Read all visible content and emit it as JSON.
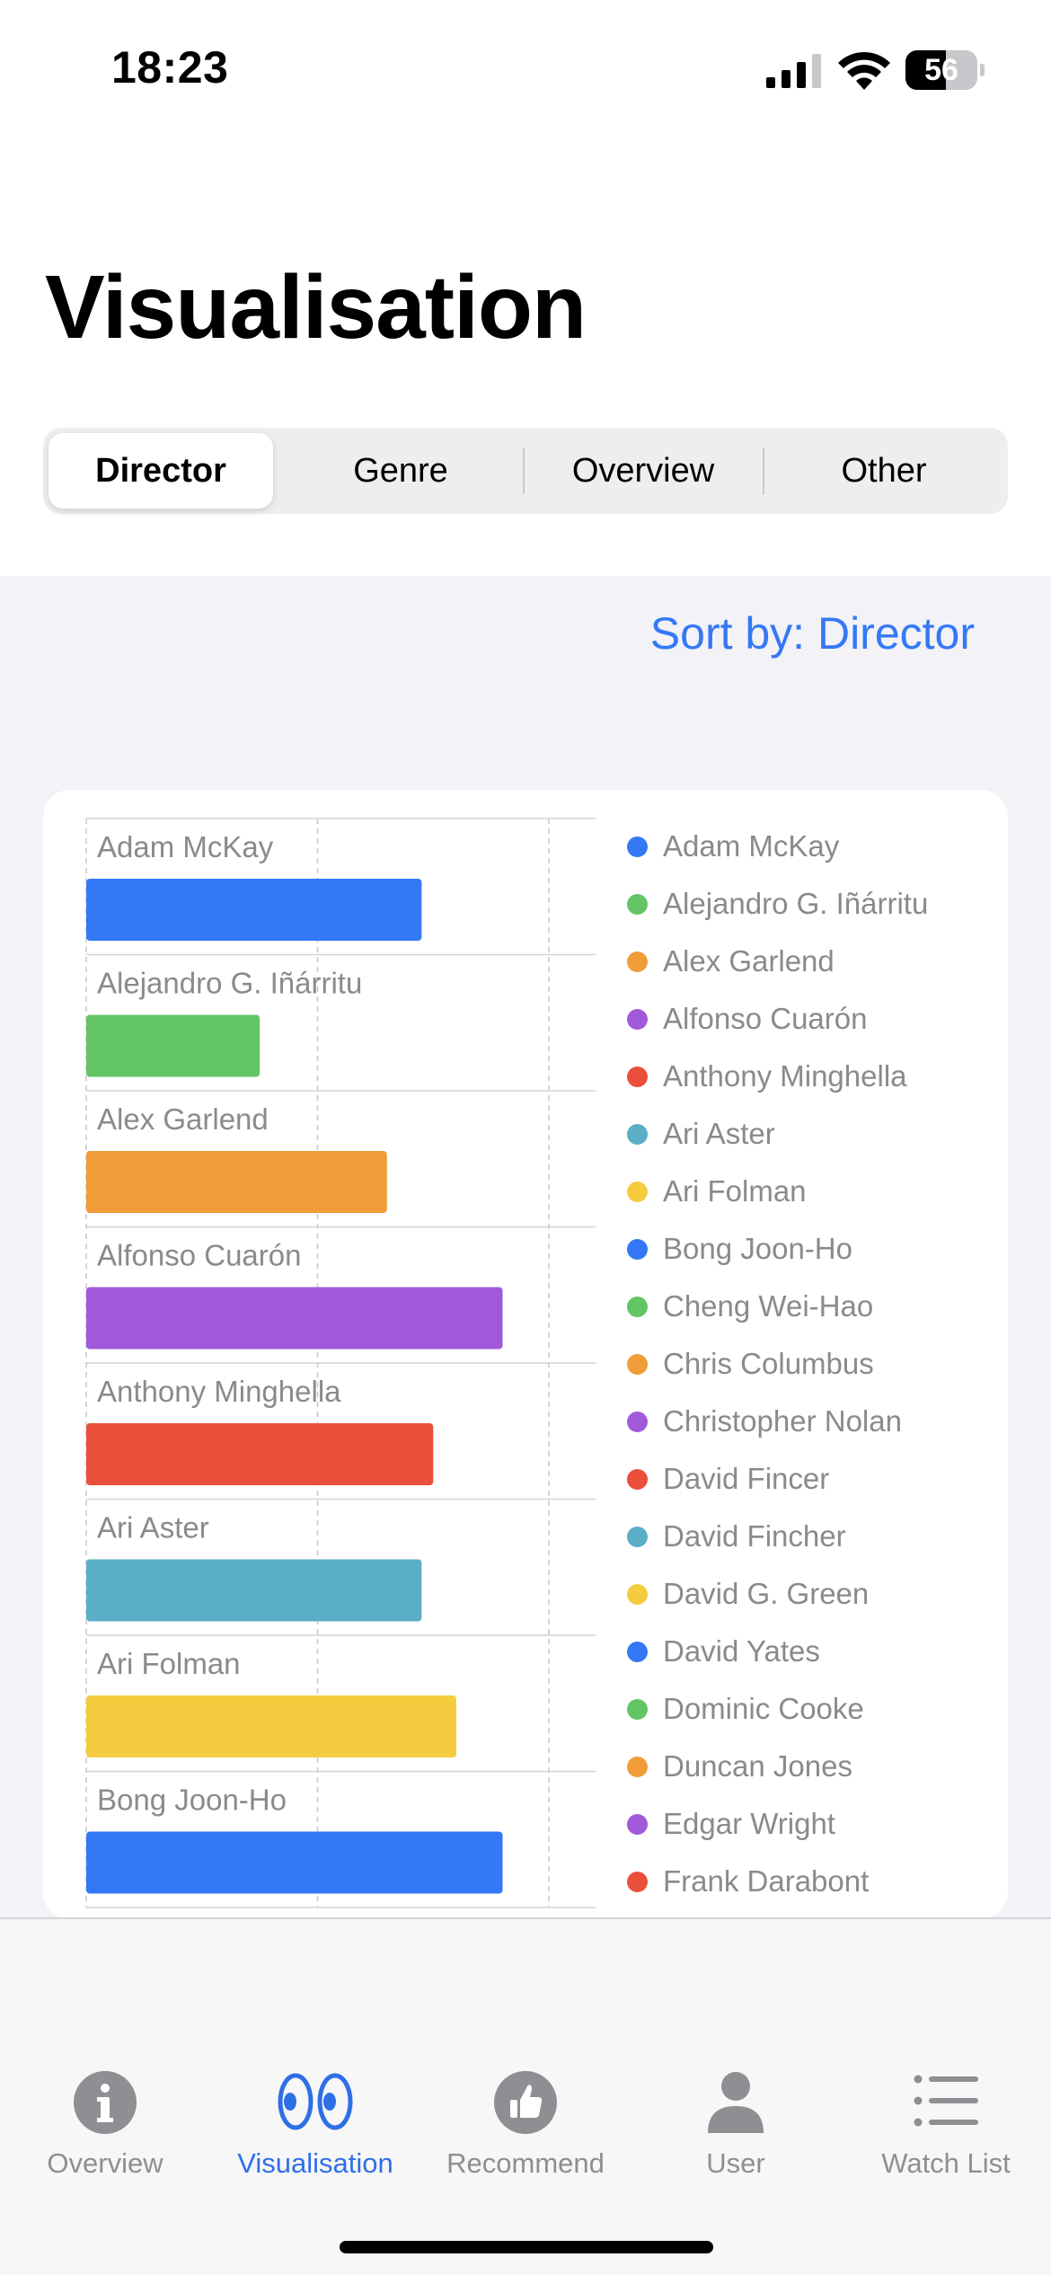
{
  "status_bar": {
    "time": "18:23",
    "battery_level": "56",
    "battery_fraction": 0.56
  },
  "page": {
    "title": "Visualisation"
  },
  "segments": [
    {
      "label": "Director",
      "selected": true
    },
    {
      "label": "Genre",
      "selected": false
    },
    {
      "label": "Overview",
      "selected": false
    },
    {
      "label": "Other",
      "selected": false
    }
  ],
  "sort": {
    "label": "Sort by: Director"
  },
  "chart_data": {
    "type": "bar",
    "orientation": "horizontal",
    "grid": true,
    "legend_position": "right",
    "xlim": [
      0,
      2
    ],
    "categories": [
      "Adam McKay",
      "Alejandro G. Iñárritu",
      "Alex Garlend",
      "Alfonso Cuarón",
      "Anthony Minghella",
      "Ari Aster",
      "Ari Folman",
      "Bong Joon-Ho"
    ],
    "values": [
      1.45,
      0.75,
      1.3,
      1.8,
      1.5,
      1.45,
      1.6,
      1.8
    ],
    "colors": [
      "#3478f6",
      "#63c466",
      "#f09c38",
      "#a259d9",
      "#ea4f3c",
      "#5aaec6",
      "#f5cc40",
      "#3478f6"
    ]
  },
  "legend": {
    "items": [
      {
        "label": "Adam McKay",
        "color": "#3478f6"
      },
      {
        "label": "Alejandro G. Iñárritu",
        "color": "#63c466"
      },
      {
        "label": "Alex Garlend",
        "color": "#f09c38"
      },
      {
        "label": "Alfonso Cuarón",
        "color": "#a259d9"
      },
      {
        "label": "Anthony Minghella",
        "color": "#ea4f3c"
      },
      {
        "label": "Ari Aster",
        "color": "#5aaec6"
      },
      {
        "label": "Ari Folman",
        "color": "#f5cc40"
      },
      {
        "label": "Bong Joon-Ho",
        "color": "#3478f6"
      },
      {
        "label": "Cheng Wei-Hao",
        "color": "#63c466"
      },
      {
        "label": "Chris Columbus",
        "color": "#f09c38"
      },
      {
        "label": "Christopher Nolan",
        "color": "#a259d9"
      },
      {
        "label": "David Fincer",
        "color": "#ea4f3c"
      },
      {
        "label": "David Fincher",
        "color": "#5aaec6"
      },
      {
        "label": "David G. Green",
        "color": "#f5cc40"
      },
      {
        "label": "David Yates",
        "color": "#3478f6"
      },
      {
        "label": "Dominic Cooke",
        "color": "#63c466"
      },
      {
        "label": "Duncan Jones",
        "color": "#f09c38"
      },
      {
        "label": "Edgar Wright",
        "color": "#a259d9"
      },
      {
        "label": "Frank Darabont",
        "color": "#ea4f3c"
      }
    ]
  },
  "tabs": [
    {
      "label": "Overview",
      "icon": "info-circle-icon",
      "active": false
    },
    {
      "label": "Visualisation",
      "icon": "eyes-icon",
      "active": true
    },
    {
      "label": "Recommend",
      "icon": "thumbs-up-icon",
      "active": false
    },
    {
      "label": "User",
      "icon": "person-icon",
      "active": false
    },
    {
      "label": "Watch List",
      "icon": "list-icon",
      "active": false
    }
  ],
  "colors": {
    "accent": "#3478f6",
    "tab_active": "#2f6fe6",
    "tab_inactive": "#8e8e93",
    "background_grouped": "#f2f2f7"
  }
}
